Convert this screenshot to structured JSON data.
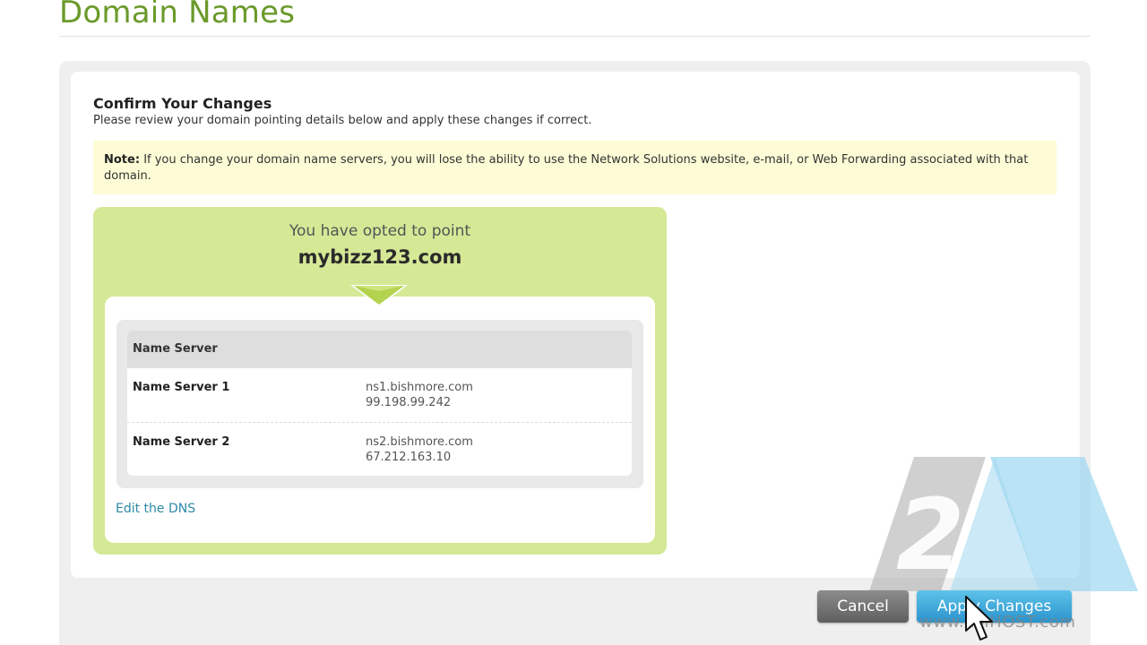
{
  "page": {
    "title": "Domain Names"
  },
  "confirm": {
    "heading": "Confirm Your Changes",
    "subtitle": "Please review your domain pointing details below and apply these changes if correct."
  },
  "note": {
    "label": "Note:",
    "text": "If you change your domain name servers, you will lose the ability to use the Network Solutions website, e-mail, or Web Forwarding associated with that domain."
  },
  "pointing": {
    "opted_text": "You have opted to point",
    "domain": "mybizz123.com"
  },
  "name_servers": {
    "header": "Name Server",
    "rows": [
      {
        "label": "Name Server 1",
        "host": "ns1.bishmore.com",
        "ip": "99.198.99.242"
      },
      {
        "label": "Name Server 2",
        "host": "ns2.bishmore.com",
        "ip": "67.212.163.10"
      }
    ]
  },
  "links": {
    "edit_dns": "Edit the DNS"
  },
  "buttons": {
    "cancel": "Cancel",
    "apply": "Apply Changes"
  },
  "watermark": {
    "numeral": "2",
    "url": "www.2MHOST.com"
  },
  "colors": {
    "title_green": "#6a9a2a",
    "panel_green": "#d4e896",
    "note_yellow": "#fdfcd6",
    "link_blue": "#2f8aa6",
    "apply_blue": "#2a93cc",
    "cancel_gray": "#6e6e6e"
  },
  "icons": {
    "pointer": "down-triangle-icon",
    "cursor": "mouse-cursor-icon",
    "watermark_logo": "2m-logo-icon"
  }
}
